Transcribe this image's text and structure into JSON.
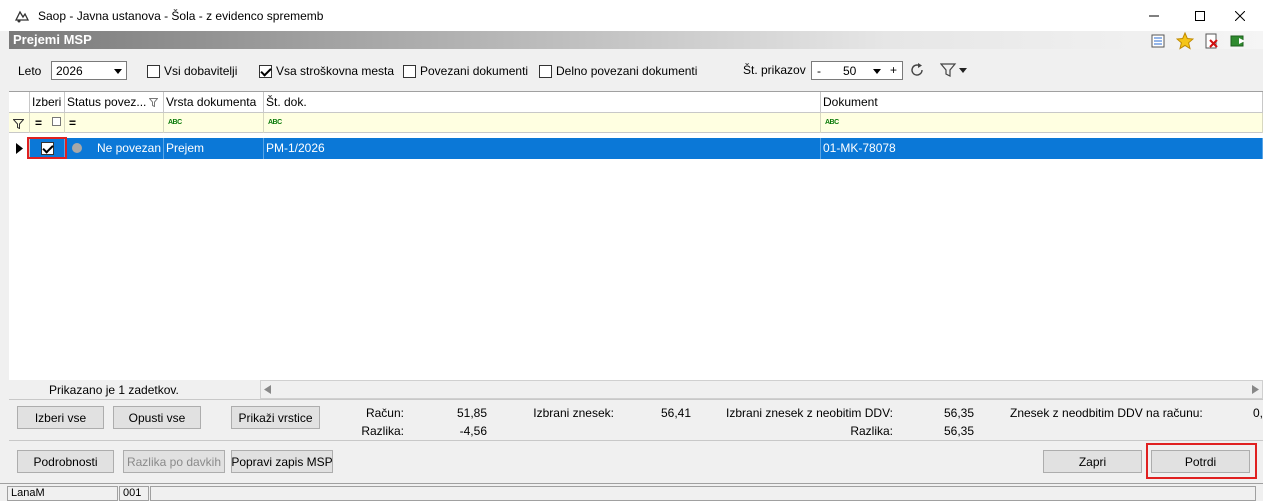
{
  "window": {
    "title": "Saop  - Javna ustanova - Šola - z evidenco sprememb",
    "controls": [
      "—",
      "☐",
      "✕"
    ]
  },
  "header": {
    "title": "Prejemi MSP"
  },
  "filters": {
    "year_label": "Leto",
    "year_value": "2026",
    "checkboxes": [
      {
        "label": "Vsi dobavitelji",
        "checked": false
      },
      {
        "label": "Vsa stroškovna mesta",
        "checked": true
      },
      {
        "label": "Povezani dokumenti",
        "checked": false
      },
      {
        "label": "Delno povezani dokumenti",
        "checked": false
      }
    ],
    "count_label": "Št. prikazov",
    "count_minus": "-",
    "count_value": "50",
    "count_plus": "+"
  },
  "grid": {
    "columns": [
      "Izberi",
      "Status povez...",
      "Vrsta dokumenta",
      "Št. dok.",
      "Dokument"
    ],
    "filter_abc": "ABC",
    "rows": [
      {
        "selected": true,
        "status": "Ne povezan",
        "type": "Prejem",
        "doc_no": "PM-1/2026",
        "document": "01-MK-78078"
      }
    ],
    "footer_text": "Prikazano je 1 zadetkov."
  },
  "buttons": {
    "select_all": "Izberi vse",
    "deselect_all": "Opusti vse",
    "show_lines": "Prikaži vrstice",
    "details": "Podrobnosti",
    "diff_by_tax": "Razlika po davkih",
    "fix_msp": "Popravi zapis MSP",
    "close": "Zapri",
    "confirm": "Potrdi"
  },
  "summary": {
    "invoice_label": "Račun:",
    "invoice_value": "51,85",
    "diff_label": "Razlika:",
    "diff_value": "-4,56",
    "selected_label": "Izbrani znesek:",
    "selected_value": "56,41",
    "selected_ddv_label": "Izbrani znesek z neobitim DDV:",
    "selected_ddv_value": "56,35",
    "diff2_label": "Razlika:",
    "diff2_value": "56,35",
    "invoice_ddv_label": "Znesek z neodbitim DDV na računu:",
    "invoice_ddv_value": "0,"
  },
  "status_bar": {
    "user": "LanaM",
    "code": "001"
  },
  "colors": {
    "selection": "#0b78d7",
    "highlight": "#e02020",
    "filter_row": "#ffffe1"
  }
}
